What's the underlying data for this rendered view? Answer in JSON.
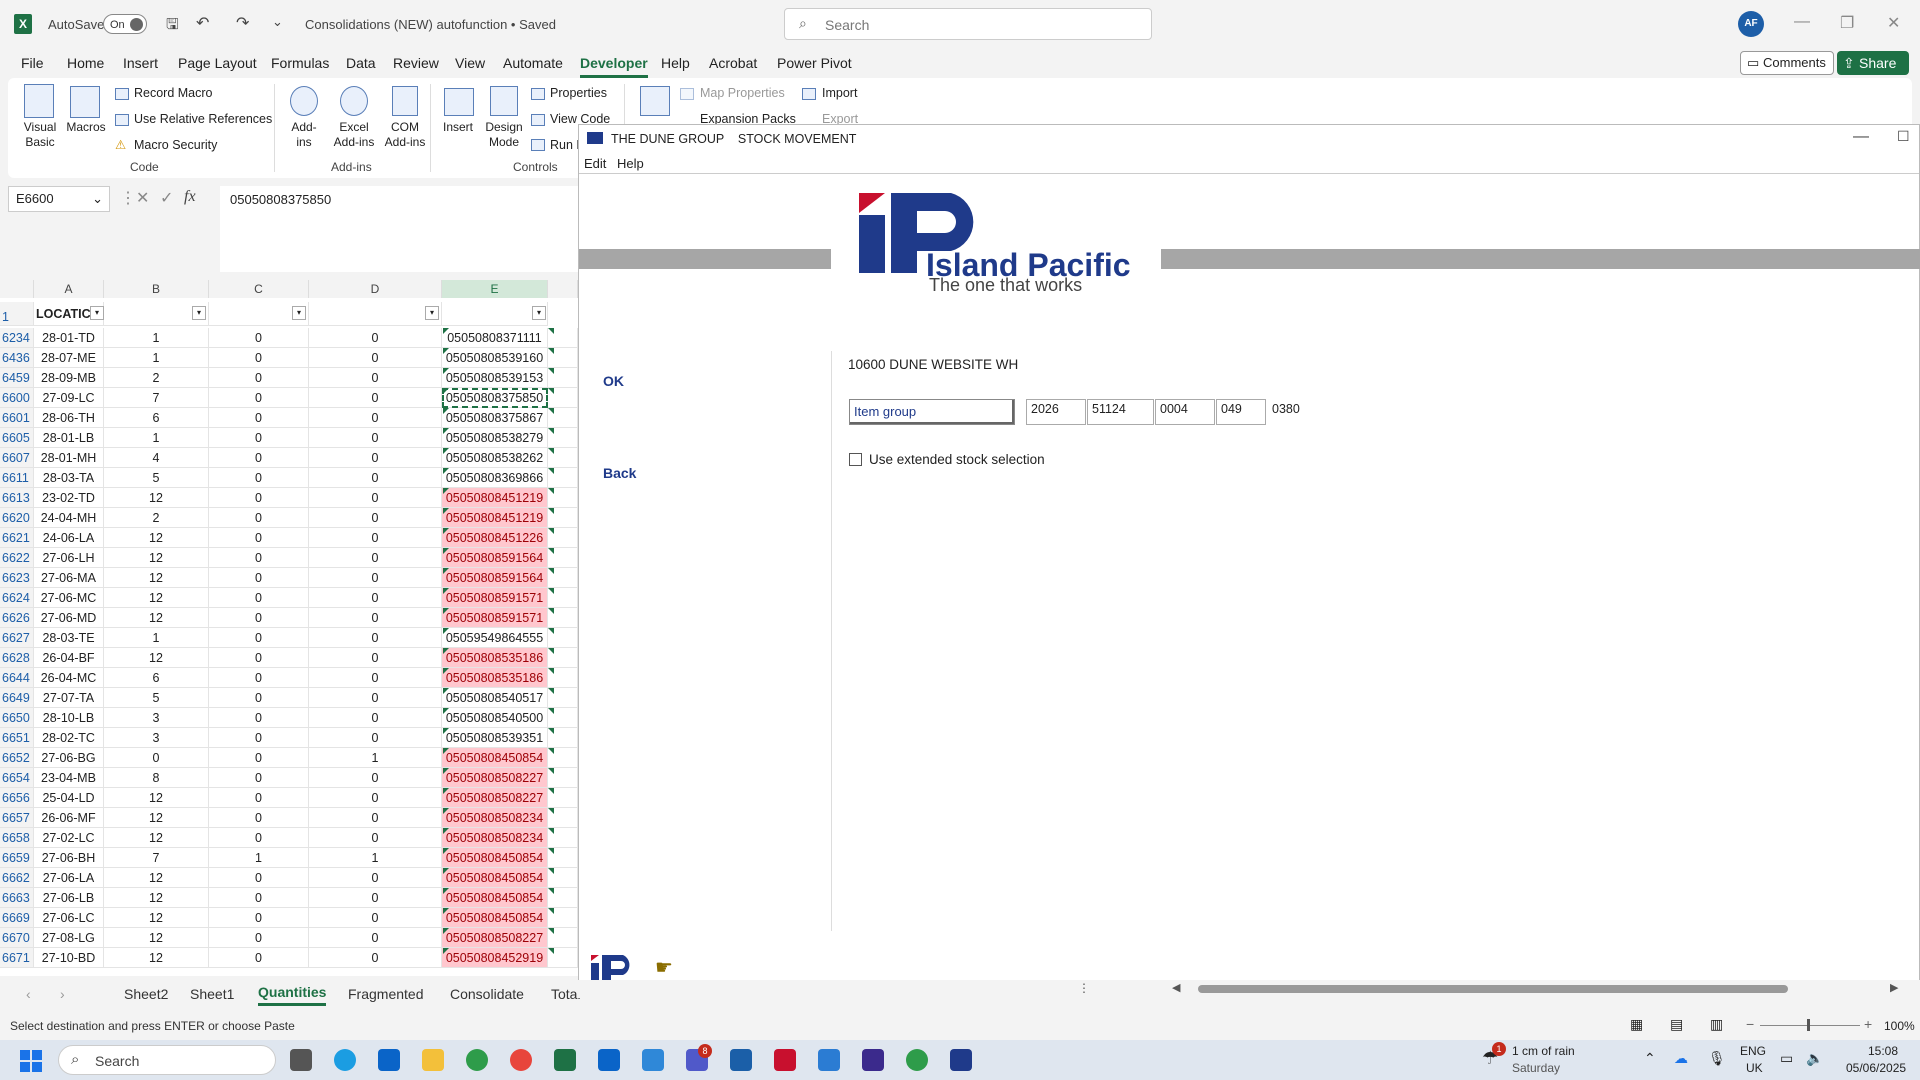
{
  "titlebar": {
    "autosave_label": "AutoSave",
    "autosave_state": "On",
    "document_title": "Consolidations (NEW) autofunction • Saved",
    "search_placeholder": "Search",
    "avatar_initials": "AF"
  },
  "menu": [
    "File",
    "Home",
    "Insert",
    "Page Layout",
    "Formulas",
    "Data",
    "Review",
    "View",
    "Automate",
    "Developer",
    "Help",
    "Acrobat",
    "Power Pivot"
  ],
  "menu_active": "Developer",
  "comments_label": "Comments",
  "share_label": "Share",
  "ribbon": {
    "visual_basic": "Visual Basic",
    "macros": "Macros",
    "record_macro": "Record Macro",
    "relative_refs": "Use Relative References",
    "macro_security": "Macro Security",
    "group_code": "Code",
    "add_ins": "Add-ins",
    "excel_add_ins": "Excel Add-ins",
    "com_add_ins": "COM Add-ins",
    "group_addins": "Add-ins",
    "insert": "Insert",
    "design_mode": "Design Mode",
    "properties": "Properties",
    "view_code": "View Code",
    "run_dialog": "Run D",
    "group_controls": "Controls",
    "map_properties": "Map Properties",
    "expansion_packs": "Expansion Packs",
    "import": "Import",
    "export": "Export"
  },
  "formula_bar": {
    "name_box": "E6600",
    "fx": "fx",
    "formula": "05050808375850"
  },
  "grid": {
    "columns": [
      "A",
      "B",
      "C",
      "D",
      "E"
    ],
    "header_row_num": "1",
    "header_a": "LOCATIC",
    "rows": [
      {
        "n": "6234",
        "a": "28-01-TD",
        "b": "1",
        "c": "0",
        "d": "0",
        "e": "05050808371111",
        "pink": false
      },
      {
        "n": "6436",
        "a": "28-07-ME",
        "b": "1",
        "c": "0",
        "d": "0",
        "e": "05050808539160",
        "pink": false
      },
      {
        "n": "6459",
        "a": "28-09-MB",
        "b": "2",
        "c": "0",
        "d": "0",
        "e": "05050808539153",
        "pink": false
      },
      {
        "n": "6600",
        "a": "27-09-LC",
        "b": "7",
        "c": "0",
        "d": "0",
        "e": "05050808375850",
        "pink": false
      },
      {
        "n": "6601",
        "a": "28-06-TH",
        "b": "6",
        "c": "0",
        "d": "0",
        "e": "05050808375867",
        "pink": false
      },
      {
        "n": "6605",
        "a": "28-01-LB",
        "b": "1",
        "c": "0",
        "d": "0",
        "e": "05050808538279",
        "pink": false
      },
      {
        "n": "6607",
        "a": "28-01-MH",
        "b": "4",
        "c": "0",
        "d": "0",
        "e": "05050808538262",
        "pink": false
      },
      {
        "n": "6611",
        "a": "28-03-TA",
        "b": "5",
        "c": "0",
        "d": "0",
        "e": "05050808369866",
        "pink": false
      },
      {
        "n": "6613",
        "a": "23-02-TD",
        "b": "12",
        "c": "0",
        "d": "0",
        "e": "05050808451219",
        "pink": true
      },
      {
        "n": "6620",
        "a": "24-04-MH",
        "b": "2",
        "c": "0",
        "d": "0",
        "e": "05050808451219",
        "pink": true
      },
      {
        "n": "6621",
        "a": "24-06-LA",
        "b": "12",
        "c": "0",
        "d": "0",
        "e": "05050808451226",
        "pink": true
      },
      {
        "n": "6622",
        "a": "27-06-LH",
        "b": "12",
        "c": "0",
        "d": "0",
        "e": "05050808591564",
        "pink": true
      },
      {
        "n": "6623",
        "a": "27-06-MA",
        "b": "12",
        "c": "0",
        "d": "0",
        "e": "05050808591564",
        "pink": true
      },
      {
        "n": "6624",
        "a": "27-06-MC",
        "b": "12",
        "c": "0",
        "d": "0",
        "e": "05050808591571",
        "pink": true
      },
      {
        "n": "6626",
        "a": "27-06-MD",
        "b": "12",
        "c": "0",
        "d": "0",
        "e": "05050808591571",
        "pink": true
      },
      {
        "n": "6627",
        "a": "28-03-TE",
        "b": "1",
        "c": "0",
        "d": "0",
        "e": "05059549864555",
        "pink": false
      },
      {
        "n": "6628",
        "a": "26-04-BF",
        "b": "12",
        "c": "0",
        "d": "0",
        "e": "05050808535186",
        "pink": true
      },
      {
        "n": "6644",
        "a": "26-04-MC",
        "b": "6",
        "c": "0",
        "d": "0",
        "e": "05050808535186",
        "pink": true
      },
      {
        "n": "6649",
        "a": "27-07-TA",
        "b": "5",
        "c": "0",
        "d": "0",
        "e": "05050808540517",
        "pink": false
      },
      {
        "n": "6650",
        "a": "28-10-LB",
        "b": "3",
        "c": "0",
        "d": "0",
        "e": "05050808540500",
        "pink": false
      },
      {
        "n": "6651",
        "a": "28-02-TC",
        "b": "3",
        "c": "0",
        "d": "0",
        "e": "05050808539351",
        "pink": false
      },
      {
        "n": "6652",
        "a": "27-06-BG",
        "b": "0",
        "c": "0",
        "d": "1",
        "e": "05050808450854",
        "pink": true
      },
      {
        "n": "6654",
        "a": "23-04-MB",
        "b": "8",
        "c": "0",
        "d": "0",
        "e": "05050808508227",
        "pink": true
      },
      {
        "n": "6656",
        "a": "25-04-LD",
        "b": "12",
        "c": "0",
        "d": "0",
        "e": "05050808508227",
        "pink": true
      },
      {
        "n": "6657",
        "a": "26-06-MF",
        "b": "12",
        "c": "0",
        "d": "0",
        "e": "05050808508234",
        "pink": true
      },
      {
        "n": "6658",
        "a": "27-02-LC",
        "b": "12",
        "c": "0",
        "d": "0",
        "e": "05050808508234",
        "pink": true
      },
      {
        "n": "6659",
        "a": "27-06-BH",
        "b": "7",
        "c": "1",
        "d": "1",
        "e": "05050808450854",
        "pink": true
      },
      {
        "n": "6662",
        "a": "27-06-LA",
        "b": "12",
        "c": "0",
        "d": "0",
        "e": "05050808450854",
        "pink": true
      },
      {
        "n": "6663",
        "a": "27-06-LB",
        "b": "12",
        "c": "0",
        "d": "0",
        "e": "05050808450854",
        "pink": true
      },
      {
        "n": "6669",
        "a": "27-06-LC",
        "b": "12",
        "c": "0",
        "d": "0",
        "e": "05050808450854",
        "pink": true
      },
      {
        "n": "6670",
        "a": "27-08-LG",
        "b": "12",
        "c": "0",
        "d": "0",
        "e": "05050808508227",
        "pink": true
      },
      {
        "n": "6671",
        "a": "27-10-BD",
        "b": "12",
        "c": "0",
        "d": "0",
        "e": "05050808452919",
        "pink": true
      }
    ]
  },
  "sheets": [
    "Sheet2",
    "Sheet1",
    "Quantities",
    "Fragmented",
    "Consolidate",
    "Total"
  ],
  "active_sheet": "Quantities",
  "status_text": "Select destination and press ENTER or choose Paste",
  "zoom": "100%",
  "dialog": {
    "title": "THE DUNE GROUP    STOCK MOVEMENT",
    "menu": [
      "Edit",
      "Help"
    ],
    "logo_text": "Island Pacific",
    "logo_tagline": "The one that works",
    "ok_label": "OK",
    "back_label": "Back",
    "warehouse": "10600 DUNE WEBSITE WH",
    "item_group_label": "Item group",
    "fields": [
      "2026",
      "51124",
      "0004",
      "049",
      "0380"
    ],
    "extended_label": "Use extended stock selection"
  },
  "taskbar": {
    "search_placeholder": "Search",
    "weather_line1": "1 cm of rain",
    "weather_line2": "Saturday",
    "weather_badge": "1",
    "teams_badge": "8",
    "lang_line1": "ENG",
    "lang_line2": "UK",
    "time": "15:08",
    "date": "05/06/2025"
  },
  "colors": {
    "excel_green": "#1e7145",
    "pink_fill": "#ffc7ce",
    "pink_text": "#9c0006",
    "ip_blue": "#1f3a8a",
    "ip_red": "#c8102e"
  }
}
